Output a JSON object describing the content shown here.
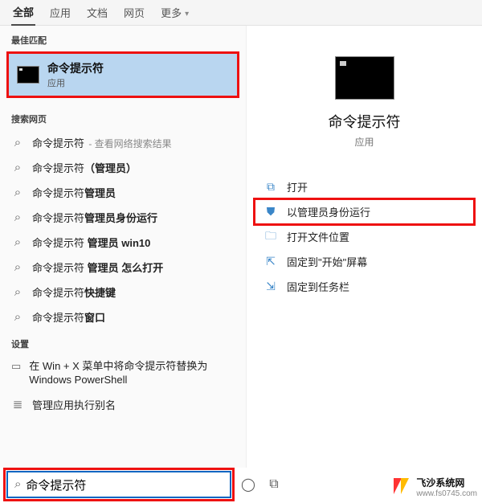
{
  "tabs": {
    "all": "全部",
    "apps": "应用",
    "docs": "文档",
    "web": "网页",
    "more": "更多"
  },
  "sections": {
    "best": "最佳匹配",
    "web": "搜索网页",
    "settings": "设置"
  },
  "best": {
    "title": "命令提示符",
    "sub": "应用"
  },
  "web_rows": [
    {
      "prefix": "命令提示符",
      "bold": "",
      "hint": " - 查看网络搜索结果"
    },
    {
      "prefix": "命令提示符",
      "bold": "（管理员）",
      "hint": ""
    },
    {
      "prefix": "命令提示符",
      "bold": "管理员",
      "hint": ""
    },
    {
      "prefix": "命令提示符",
      "bold": "管理员身份运行",
      "hint": ""
    },
    {
      "prefix": "命令提示符",
      "bold": " 管理员 win10",
      "hint": ""
    },
    {
      "prefix": "命令提示符",
      "bold": " 管理员 怎么打开",
      "hint": ""
    },
    {
      "prefix": "命令提示符",
      "bold": "快捷键",
      "hint": ""
    },
    {
      "prefix": "命令提示符",
      "bold": "窗口",
      "hint": ""
    }
  ],
  "settings_rows": [
    {
      "text": "在 Win + X 菜单中将命令提示符替换为 Windows PowerShell",
      "glyph": "box"
    },
    {
      "text": "管理应用执行别名",
      "glyph": "list3"
    }
  ],
  "detail": {
    "title": "命令提示符",
    "sub": "应用",
    "actions": {
      "open": "打开",
      "admin": "以管理员身份运行",
      "loc": "打开文件位置",
      "pin_start": "固定到\"开始\"屏幕",
      "pin_task": "固定到任务栏"
    }
  },
  "search": {
    "value": "命令提示符"
  },
  "watermark": {
    "name": "飞沙系统网",
    "url": "www.fs0745.com"
  }
}
